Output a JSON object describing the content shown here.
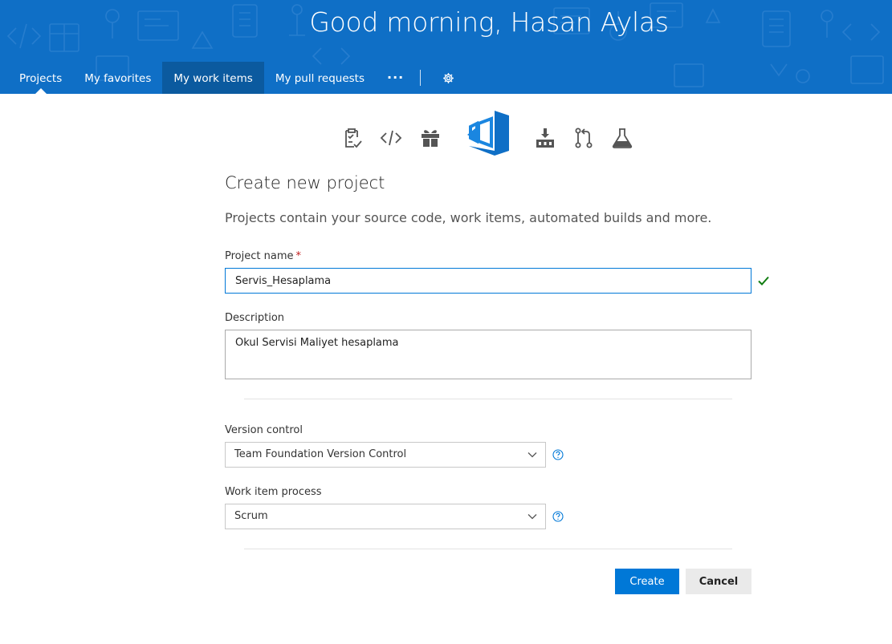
{
  "header": {
    "greeting": "Good morning, Hasan Aylas",
    "background_color": "#0f6fc6"
  },
  "nav": {
    "items": [
      {
        "label": "Projects",
        "active": true
      },
      {
        "label": "My favorites",
        "active": false
      },
      {
        "label": "My work items",
        "active": false
      },
      {
        "label": "My pull requests",
        "active": false
      }
    ],
    "more_icon": "ellipsis-icon",
    "settings_icon": "gear-icon"
  },
  "service_icons": [
    "task-checklist-icon",
    "code-icon",
    "gift-icon",
    "vsts-logo-icon",
    "build-icon",
    "pull-request-icon",
    "flask-icon"
  ],
  "form": {
    "title": "Create new project",
    "subtitle": "Projects contain your source code, work items, automated builds and more.",
    "project_name": {
      "label": "Project name",
      "required_mark": "*",
      "value": "Servis_Hesaplama"
    },
    "description": {
      "label": "Description",
      "value": "Okul Servisi Maliyet hesaplama"
    },
    "version_control": {
      "label": "Version control",
      "selected": "Team Foundation Version Control"
    },
    "work_item_process": {
      "label": "Work item process",
      "selected": "Scrum"
    },
    "create_label": "Create",
    "cancel_label": "Cancel"
  },
  "colors": {
    "accent": "#0078d7",
    "success": "#107c10",
    "required": "#c21d1d"
  }
}
